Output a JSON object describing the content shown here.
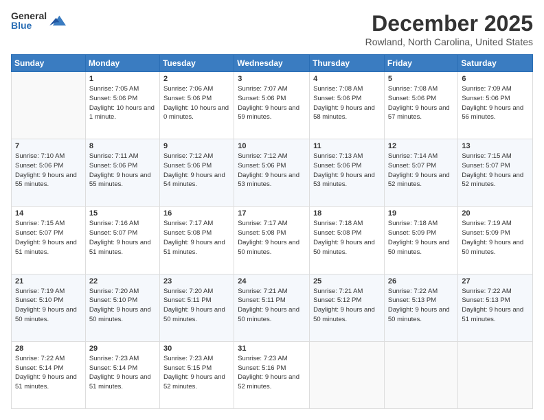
{
  "logo": {
    "general": "General",
    "blue": "Blue"
  },
  "header": {
    "month": "December 2025",
    "location": "Rowland, North Carolina, United States"
  },
  "weekdays": [
    "Sunday",
    "Monday",
    "Tuesday",
    "Wednesday",
    "Thursday",
    "Friday",
    "Saturday"
  ],
  "weeks": [
    [
      {
        "day": "",
        "sunrise": "",
        "sunset": "",
        "daylight": ""
      },
      {
        "day": "1",
        "sunrise": "Sunrise: 7:05 AM",
        "sunset": "Sunset: 5:06 PM",
        "daylight": "Daylight: 10 hours and 1 minute."
      },
      {
        "day": "2",
        "sunrise": "Sunrise: 7:06 AM",
        "sunset": "Sunset: 5:06 PM",
        "daylight": "Daylight: 10 hours and 0 minutes."
      },
      {
        "day": "3",
        "sunrise": "Sunrise: 7:07 AM",
        "sunset": "Sunset: 5:06 PM",
        "daylight": "Daylight: 9 hours and 59 minutes."
      },
      {
        "day": "4",
        "sunrise": "Sunrise: 7:08 AM",
        "sunset": "Sunset: 5:06 PM",
        "daylight": "Daylight: 9 hours and 58 minutes."
      },
      {
        "day": "5",
        "sunrise": "Sunrise: 7:08 AM",
        "sunset": "Sunset: 5:06 PM",
        "daylight": "Daylight: 9 hours and 57 minutes."
      },
      {
        "day": "6",
        "sunrise": "Sunrise: 7:09 AM",
        "sunset": "Sunset: 5:06 PM",
        "daylight": "Daylight: 9 hours and 56 minutes."
      }
    ],
    [
      {
        "day": "7",
        "sunrise": "Sunrise: 7:10 AM",
        "sunset": "Sunset: 5:06 PM",
        "daylight": "Daylight: 9 hours and 55 minutes."
      },
      {
        "day": "8",
        "sunrise": "Sunrise: 7:11 AM",
        "sunset": "Sunset: 5:06 PM",
        "daylight": "Daylight: 9 hours and 55 minutes."
      },
      {
        "day": "9",
        "sunrise": "Sunrise: 7:12 AM",
        "sunset": "Sunset: 5:06 PM",
        "daylight": "Daylight: 9 hours and 54 minutes."
      },
      {
        "day": "10",
        "sunrise": "Sunrise: 7:12 AM",
        "sunset": "Sunset: 5:06 PM",
        "daylight": "Daylight: 9 hours and 53 minutes."
      },
      {
        "day": "11",
        "sunrise": "Sunrise: 7:13 AM",
        "sunset": "Sunset: 5:06 PM",
        "daylight": "Daylight: 9 hours and 53 minutes."
      },
      {
        "day": "12",
        "sunrise": "Sunrise: 7:14 AM",
        "sunset": "Sunset: 5:07 PM",
        "daylight": "Daylight: 9 hours and 52 minutes."
      },
      {
        "day": "13",
        "sunrise": "Sunrise: 7:15 AM",
        "sunset": "Sunset: 5:07 PM",
        "daylight": "Daylight: 9 hours and 52 minutes."
      }
    ],
    [
      {
        "day": "14",
        "sunrise": "Sunrise: 7:15 AM",
        "sunset": "Sunset: 5:07 PM",
        "daylight": "Daylight: 9 hours and 51 minutes."
      },
      {
        "day": "15",
        "sunrise": "Sunrise: 7:16 AM",
        "sunset": "Sunset: 5:07 PM",
        "daylight": "Daylight: 9 hours and 51 minutes."
      },
      {
        "day": "16",
        "sunrise": "Sunrise: 7:17 AM",
        "sunset": "Sunset: 5:08 PM",
        "daylight": "Daylight: 9 hours and 51 minutes."
      },
      {
        "day": "17",
        "sunrise": "Sunrise: 7:17 AM",
        "sunset": "Sunset: 5:08 PM",
        "daylight": "Daylight: 9 hours and 50 minutes."
      },
      {
        "day": "18",
        "sunrise": "Sunrise: 7:18 AM",
        "sunset": "Sunset: 5:08 PM",
        "daylight": "Daylight: 9 hours and 50 minutes."
      },
      {
        "day": "19",
        "sunrise": "Sunrise: 7:18 AM",
        "sunset": "Sunset: 5:09 PM",
        "daylight": "Daylight: 9 hours and 50 minutes."
      },
      {
        "day": "20",
        "sunrise": "Sunrise: 7:19 AM",
        "sunset": "Sunset: 5:09 PM",
        "daylight": "Daylight: 9 hours and 50 minutes."
      }
    ],
    [
      {
        "day": "21",
        "sunrise": "Sunrise: 7:19 AM",
        "sunset": "Sunset: 5:10 PM",
        "daylight": "Daylight: 9 hours and 50 minutes."
      },
      {
        "day": "22",
        "sunrise": "Sunrise: 7:20 AM",
        "sunset": "Sunset: 5:10 PM",
        "daylight": "Daylight: 9 hours and 50 minutes."
      },
      {
        "day": "23",
        "sunrise": "Sunrise: 7:20 AM",
        "sunset": "Sunset: 5:11 PM",
        "daylight": "Daylight: 9 hours and 50 minutes."
      },
      {
        "day": "24",
        "sunrise": "Sunrise: 7:21 AM",
        "sunset": "Sunset: 5:11 PM",
        "daylight": "Daylight: 9 hours and 50 minutes."
      },
      {
        "day": "25",
        "sunrise": "Sunrise: 7:21 AM",
        "sunset": "Sunset: 5:12 PM",
        "daylight": "Daylight: 9 hours and 50 minutes."
      },
      {
        "day": "26",
        "sunrise": "Sunrise: 7:22 AM",
        "sunset": "Sunset: 5:13 PM",
        "daylight": "Daylight: 9 hours and 50 minutes."
      },
      {
        "day": "27",
        "sunrise": "Sunrise: 7:22 AM",
        "sunset": "Sunset: 5:13 PM",
        "daylight": "Daylight: 9 hours and 51 minutes."
      }
    ],
    [
      {
        "day": "28",
        "sunrise": "Sunrise: 7:22 AM",
        "sunset": "Sunset: 5:14 PM",
        "daylight": "Daylight: 9 hours and 51 minutes."
      },
      {
        "day": "29",
        "sunrise": "Sunrise: 7:23 AM",
        "sunset": "Sunset: 5:14 PM",
        "daylight": "Daylight: 9 hours and 51 minutes."
      },
      {
        "day": "30",
        "sunrise": "Sunrise: 7:23 AM",
        "sunset": "Sunset: 5:15 PM",
        "daylight": "Daylight: 9 hours and 52 minutes."
      },
      {
        "day": "31",
        "sunrise": "Sunrise: 7:23 AM",
        "sunset": "Sunset: 5:16 PM",
        "daylight": "Daylight: 9 hours and 52 minutes."
      },
      {
        "day": "",
        "sunrise": "",
        "sunset": "",
        "daylight": ""
      },
      {
        "day": "",
        "sunrise": "",
        "sunset": "",
        "daylight": ""
      },
      {
        "day": "",
        "sunrise": "",
        "sunset": "",
        "daylight": ""
      }
    ]
  ]
}
